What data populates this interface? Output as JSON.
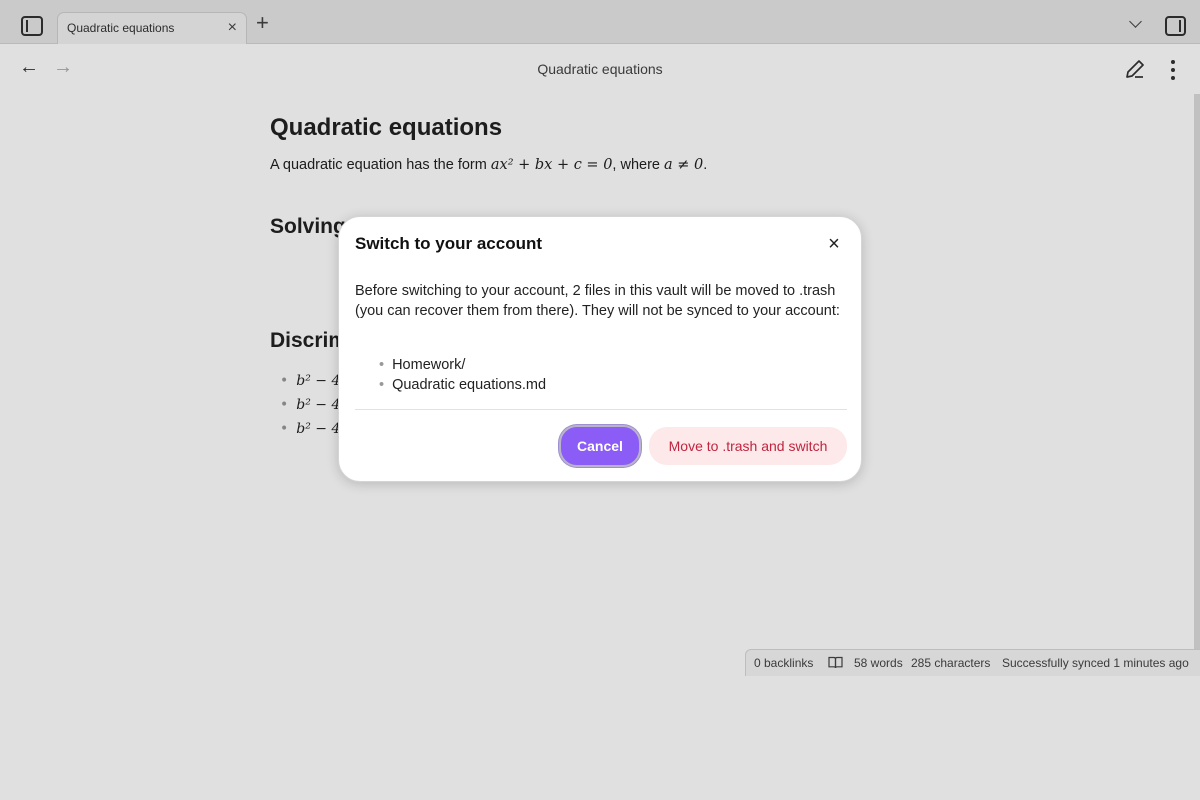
{
  "tabbar": {
    "tab_label": "Quadratic equations",
    "close_glyph": "×",
    "new_tab_glyph": "+"
  },
  "nav": {
    "back_glyph": "←",
    "forward_glyph": "→",
    "title": "Quadratic equations"
  },
  "document": {
    "heading": "Quadratic equations",
    "intro_text": "A quadratic equation has the form ",
    "intro_math": "ax² + bx + c = 0",
    "intro_mid": ", where ",
    "intro_math2": "a ≠ 0",
    "intro_end": ".",
    "section_solving": "Solving",
    "section_discriminant": "Discrim",
    "bullets": [
      "b² − 4a",
      "b² − 4a",
      "b² − 4a"
    ]
  },
  "modal": {
    "title": "Switch to your account",
    "close_glyph": "×",
    "body": "Before switching to your account, 2 files in this vault will be moved to .trash (you can recover them from there). They will not be synced to your account:",
    "files": [
      "Homework/",
      "Quadratic equations.md"
    ],
    "cancel_label": "Cancel",
    "confirm_label": "Move to .trash and switch"
  },
  "statusbar": {
    "backlinks": "0 backlinks",
    "words": "58 words",
    "characters": "285 characters",
    "sync": "Successfully synced 1 minutes ago"
  },
  "colors": {
    "accent": "#8b5cf6",
    "danger_text": "#c0253f",
    "danger_bg": "#fde8ea"
  },
  "icons": [
    "sidebar-toggle-icon",
    "close-icon",
    "plus-icon",
    "chevron-down-icon",
    "right-sidebar-icon",
    "arrow-left-icon",
    "arrow-right-icon",
    "pencil-icon",
    "more-vertical-icon",
    "book-icon"
  ]
}
